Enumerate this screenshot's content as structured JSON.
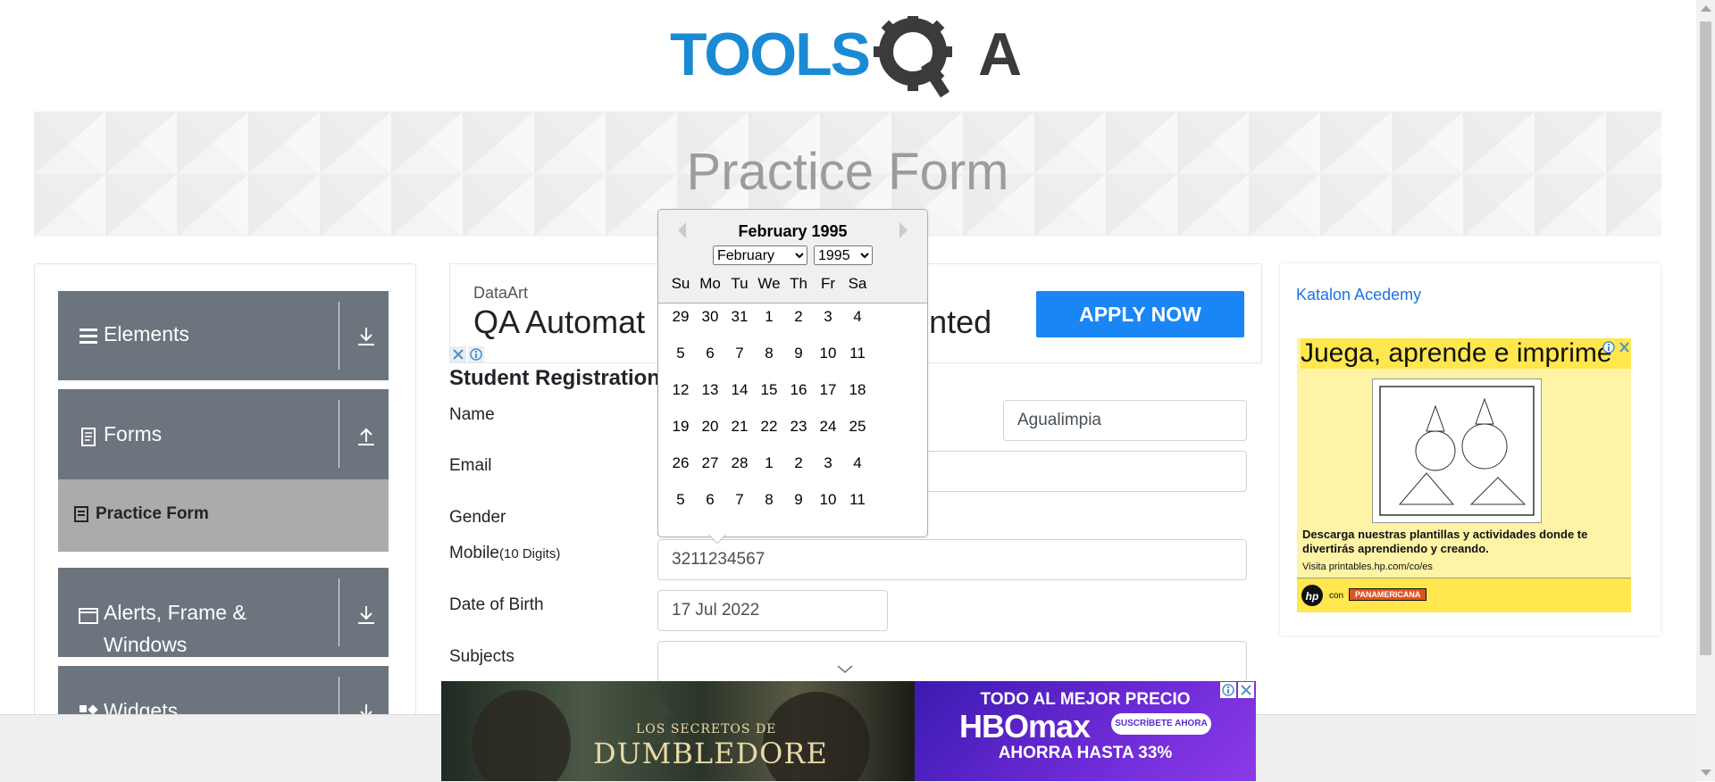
{
  "header": {
    "logo_text_left": "TOOLS",
    "logo_text_right": "A",
    "page_title": "Practice Form"
  },
  "sidebar": {
    "groups": [
      {
        "label": "Elements",
        "icon": "menu-icon",
        "arrow": "download-icon"
      },
      {
        "label": "Forms",
        "icon": "document-icon",
        "arrow": "upload-icon"
      },
      {
        "label": "Alerts, Frame &",
        "label2": "Windows",
        "icon": "window-icon",
        "arrow": "download-icon"
      },
      {
        "label": "Widgets",
        "icon": "widgets-icon",
        "arrow": "download-icon"
      }
    ],
    "active_item": "Practice Form"
  },
  "ad_center": {
    "brand": "DataArt",
    "headline": "QA Automat",
    "headline_tail": "nted",
    "button": "APPLY NOW"
  },
  "form": {
    "heading": "Student Registration",
    "labels": {
      "name": "Name",
      "email": "Email",
      "gender": "Gender",
      "mobile": "Mobile",
      "mobile_hint": "(10 Digits)",
      "dob": "Date of Birth",
      "subjects": "Subjects"
    },
    "values": {
      "last_name": "Agualimpia",
      "mobile": "3211234567",
      "dob": "17 Jul 2022"
    }
  },
  "datepicker": {
    "title": "February 1995",
    "month_select": "February",
    "year_select": "1995",
    "weekdays": [
      "Su",
      "Mo",
      "Tu",
      "We",
      "Th",
      "Fr",
      "Sa"
    ],
    "weeks": [
      [
        "29",
        "30",
        "31",
        "1",
        "2",
        "3",
        "4"
      ],
      [
        "5",
        "6",
        "7",
        "8",
        "9",
        "10",
        "11"
      ],
      [
        "12",
        "13",
        "14",
        "15",
        "16",
        "17",
        "18"
      ],
      [
        "19",
        "20",
        "21",
        "22",
        "23",
        "24",
        "25"
      ],
      [
        "26",
        "27",
        "28",
        "1",
        "2",
        "3",
        "4"
      ],
      [
        "5",
        "6",
        "7",
        "8",
        "9",
        "10",
        "11"
      ]
    ]
  },
  "ad_right": {
    "link_text": "Katalon Acedemy",
    "title": "Juega, aprende e imprime",
    "description": "Descarga nuestras plantillas y actividades donde te divertirás aprendiendo y creando.",
    "url": "Visita printables.hp.com/co/es",
    "brand_con": "con",
    "brand_partner": "PANAMERICANA"
  },
  "ad_bottom": {
    "movie_sub": "LOS SECRETOS DE",
    "movie_title": "DUMBLEDORE",
    "promo_top": "TODO AL MEJOR PRECIO",
    "promo_logo": "HBOmax",
    "promo_button": "SUSCRÍBETE AHORA",
    "promo_save": "AHORRA HASTA 33%"
  }
}
